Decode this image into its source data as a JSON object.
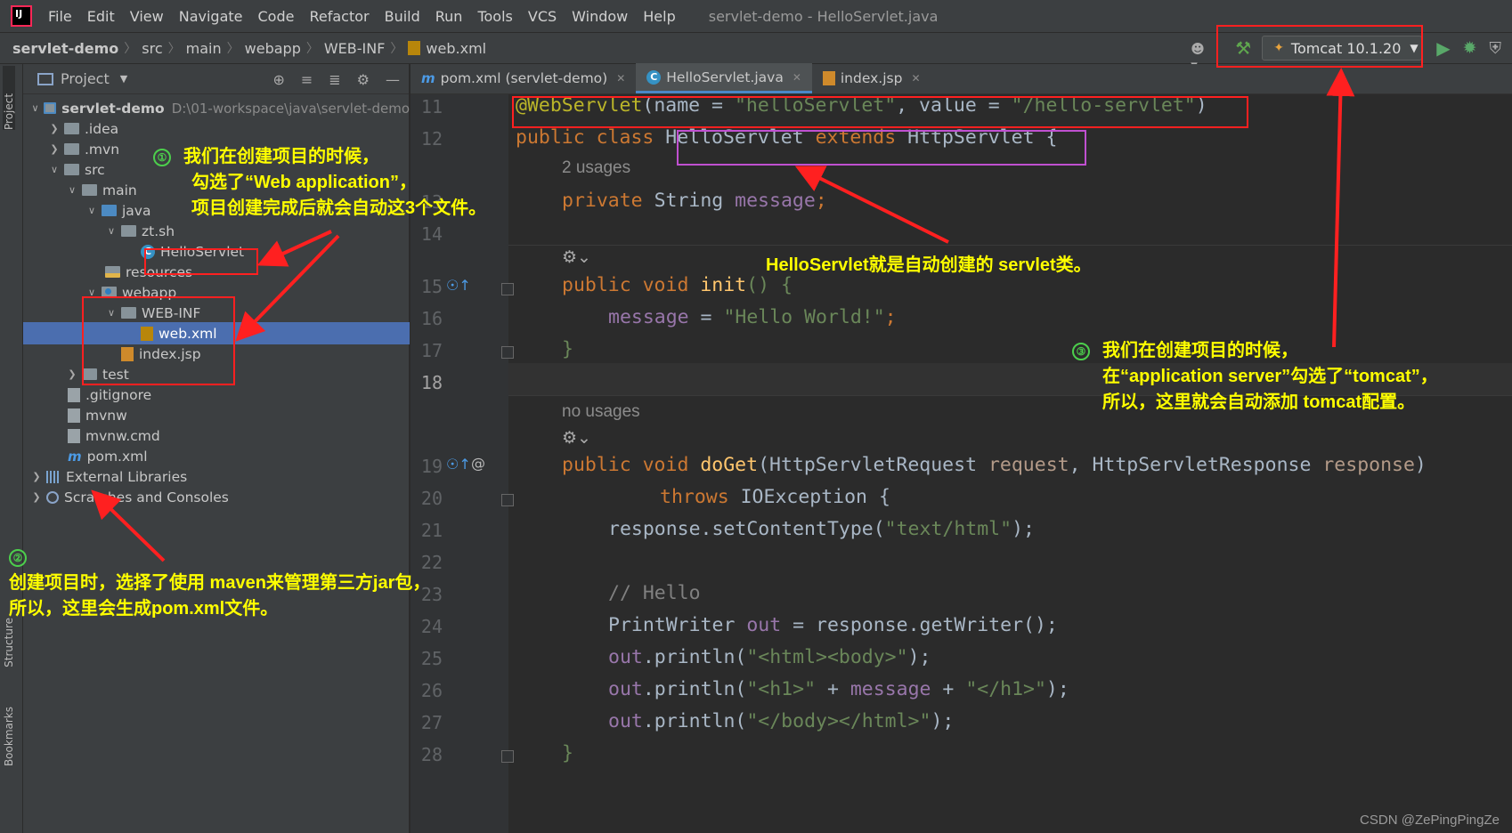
{
  "menubar": {
    "items": [
      {
        "label": "File",
        "key": "F"
      },
      {
        "label": "Edit",
        "key": "E"
      },
      {
        "label": "View",
        "key": "V"
      },
      {
        "label": "Navigate",
        "key": "N"
      },
      {
        "label": "Code",
        "key": "C"
      },
      {
        "label": "Refactor",
        "key": "R"
      },
      {
        "label": "Build",
        "key": "B"
      },
      {
        "label": "Run",
        "key": "u"
      },
      {
        "label": "Tools",
        "key": "T"
      },
      {
        "label": "VCS",
        "key": "S"
      },
      {
        "label": "Window",
        "key": "W"
      },
      {
        "label": "Help",
        "key": "H"
      }
    ],
    "window_title": "servlet-demo - HelloServlet.java"
  },
  "breadcrumb": [
    "servlet-demo",
    "src",
    "main",
    "webapp",
    "WEB-INF",
    "web.xml"
  ],
  "toolbar": {
    "run_config": "Tomcat 10.1.20"
  },
  "left_strip": {
    "project_tab": "Project",
    "structure_tab": "Structure",
    "bookmarks_tab": "Bookmarks"
  },
  "project_panel": {
    "title": "Project",
    "tree": [
      {
        "label": "servlet-demo",
        "path": "D:\\01-workspace\\java\\servlet-demo"
      },
      {
        "label": ".idea"
      },
      {
        "label": ".mvn"
      },
      {
        "label": "src"
      },
      {
        "label": "main"
      },
      {
        "label": "java"
      },
      {
        "label": "zt.sh"
      },
      {
        "label": "HelloServlet"
      },
      {
        "label": "resources"
      },
      {
        "label": "webapp"
      },
      {
        "label": "WEB-INF"
      },
      {
        "label": "web.xml"
      },
      {
        "label": "index.jsp"
      },
      {
        "label": "test"
      },
      {
        "label": ".gitignore"
      },
      {
        "label": "mvnw"
      },
      {
        "label": "mvnw.cmd"
      },
      {
        "label": "pom.xml"
      },
      {
        "label": "External Libraries"
      },
      {
        "label": "Scratches and Consoles"
      }
    ]
  },
  "editor": {
    "tabs": [
      {
        "label": "pom.xml (servlet-demo)",
        "active": false
      },
      {
        "label": "HelloServlet.java",
        "active": true
      },
      {
        "label": "index.jsp",
        "active": false
      }
    ],
    "line_numbers": [
      "11",
      "12",
      "13",
      "14",
      "15",
      "16",
      "17",
      "18",
      "19",
      "20",
      "21",
      "22",
      "23",
      "24",
      "25",
      "26",
      "27",
      "28"
    ],
    "hints": {
      "usages_2": "2 usages",
      "no_usages": "no usages"
    },
    "code": {
      "l11_ann": "@WebServlet",
      "l11_a": "(name = ",
      "l11_s1": "\"helloServlet\"",
      "l11_b": ", value = ",
      "l11_s2": "\"/hello-servlet\"",
      "l11_c": ")",
      "l12_kw": "public class ",
      "l12_cls": "HelloServlet ",
      "l12_kw2": "extends ",
      "l12_sup": "HttpServlet",
      "l12_end": " {",
      "l13_kw": "private ",
      "l13_type": "String ",
      "l13_fd": "message",
      "l13_end": ";",
      "l15_kw": "public void ",
      "l15_fn": "init",
      "l15_end": "() {",
      "l16_fd": "message",
      "l16_eq": " = ",
      "l16_st": "\"Hello World!\"",
      "l16_end": ";",
      "l17": "}",
      "l19_kw": "public void ",
      "l19_fn": "doGet",
      "l19_a": "(HttpServletRequest ",
      "l19_p1": "request",
      "l19_b": ", HttpServletResponse ",
      "l19_p2": "response",
      "l19_c": ")",
      "l20_kw": "throws ",
      "l20_rest": "IOException {",
      "l21_a": "response.setContentType(",
      "l21_s": "\"text/html\"",
      "l21_b": ");",
      "l23": "// Hello",
      "l24_a": "PrintWriter ",
      "l24_fd": "out",
      "l24_b": " = response.getWriter();",
      "l25_fd": "out",
      "l25_a": ".println(",
      "l25_s": "\"<html><body>\"",
      "l25_b": ");",
      "l26_fd": "out",
      "l26_a": ".println(",
      "l26_s1": "\"<h1>\"",
      "l26_b": " + ",
      "l26_fd2": "message",
      "l26_c": " + ",
      "l26_s2": "\"</h1>\"",
      "l26_d": ");",
      "l27_fd": "out",
      "l27_a": ".println(",
      "l27_s": "\"</body></html>\"",
      "l27_b": ");",
      "l28": "}"
    }
  },
  "annotations": {
    "note1_badge": "①",
    "note1_lines": [
      "我们在创建项目的时候，",
      "勾选了“Web application”，",
      "项目创建完成后就会自动这3个文件。"
    ],
    "note2_badge": "②",
    "note2_lines": [
      "创建项目时，选择了使用 maven来管理第三方jar包，",
      "所以，这里会生成pom.xml文件。"
    ],
    "note3_badge": "③",
    "note3_lines": [
      "我们在创建项目的时候，",
      "在“application server”勾选了“tomcat”，",
      "所以，这里就会自动添加 tomcat配置。"
    ],
    "servlet_note": "HelloServlet就是自动创建的 servlet类。",
    "arrow_color": "#ff2020"
  },
  "watermark": "CSDN @ZePingPingZe"
}
